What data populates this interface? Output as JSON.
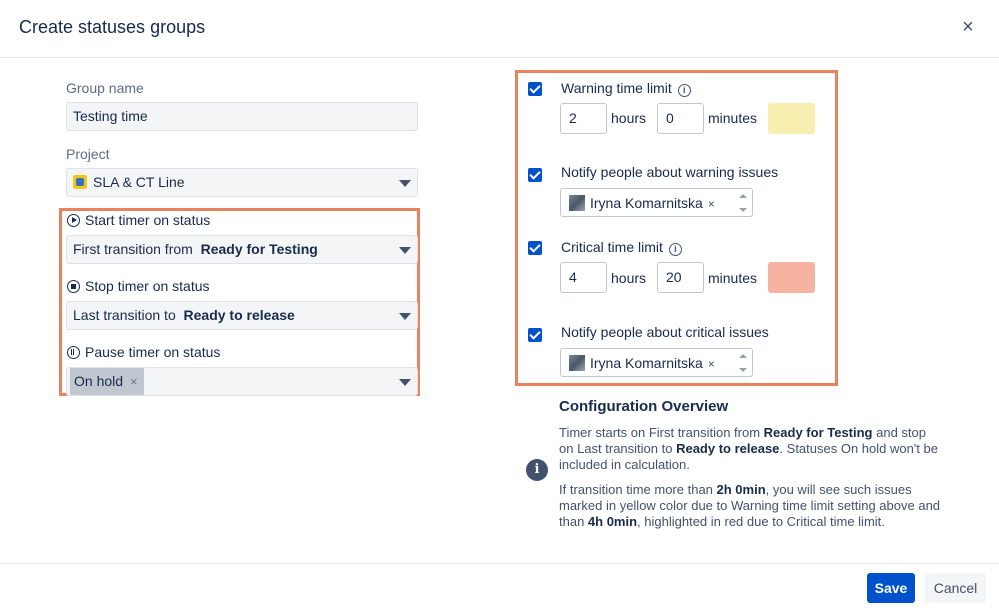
{
  "dialog": {
    "title": "Create statuses groups",
    "close_symbol": "×"
  },
  "left": {
    "group_name_label": "Group name",
    "group_name_value": "Testing time",
    "project_label": "Project",
    "project_value": "SLA & CT Line",
    "start": {
      "label": "Start timer on status",
      "prefix": "First transition from",
      "status": "Ready for Testing"
    },
    "stop": {
      "label": "Stop timer on status",
      "prefix": "Last transition to",
      "status": "Ready to release"
    },
    "pause": {
      "label": "Pause timer on status",
      "chip": "On hold",
      "chip_remove": "×"
    }
  },
  "right": {
    "warning": {
      "label": "Warning time limit",
      "hours": "2",
      "hours_unit": "hours",
      "minutes": "0",
      "minutes_unit": "minutes",
      "color": "#f8efb0"
    },
    "notify_warning": {
      "label": "Notify people about warning issues",
      "user": "Iryna Komarnitska",
      "remove": "×"
    },
    "critical": {
      "label": "Critical time limit",
      "hours": "4",
      "hours_unit": "hours",
      "minutes": "20",
      "minutes_unit": "minutes",
      "color": "#f7b3a2"
    },
    "notify_critical": {
      "label": "Notify people about critical issues",
      "user": "Iryna Komarnitska",
      "remove": "×"
    },
    "info_glyph": "i"
  },
  "overview": {
    "title": "Configuration Overview",
    "icon": "i",
    "p1": {
      "t1": "Timer starts on First transition from ",
      "b1": "Ready for Testing",
      "t2": " and stop on Last transition to ",
      "b2": "Ready to release",
      "t3": ". Statuses On hold won't be included in calculation."
    },
    "p2": {
      "t1": "If transition time more than ",
      "b1": "2h 0min",
      "t2": ", you will see such issues marked in yellow color due to Warning time limit setting above and than ",
      "b2": "4h 0min",
      "t3": ", highlighted in red due to Critical time limit."
    }
  },
  "footer": {
    "save": "Save",
    "cancel": "Cancel"
  },
  "colors": {
    "accent": "#0052cc",
    "highlight": "#e9825e",
    "warning": "#f8efb0",
    "critical": "#f7b3a2"
  }
}
